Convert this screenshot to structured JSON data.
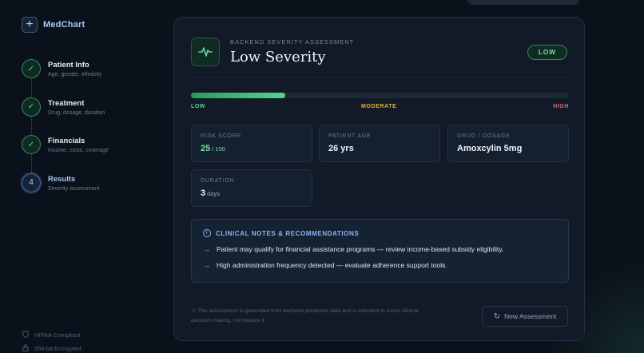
{
  "brand": {
    "icon": "plus-icon",
    "name": "MedChart"
  },
  "steps": [
    {
      "title": "Patient Info",
      "subtitle": "Age, gender, ethnicity",
      "marker": "✓",
      "state": "done"
    },
    {
      "title": "Treatment",
      "subtitle": "Drug, dosage, duration",
      "marker": "✓",
      "state": "done"
    },
    {
      "title": "Financials",
      "subtitle": "Income, costs, coverage",
      "marker": "✓",
      "state": "done"
    },
    {
      "title": "Results",
      "subtitle": "Severity assessment",
      "marker": "4",
      "state": "active"
    }
  ],
  "footer_badges": [
    {
      "icon": "shield-icon",
      "label": "HIPAA Compliant"
    },
    {
      "icon": "lock-icon",
      "label": "256-bit Encrypted"
    }
  ],
  "assessment": {
    "eyebrow": "BACKEND SEVERITY ASSESSMENT",
    "title": "Low Severity",
    "severity_badge": "LOW",
    "icon": "pulse-icon",
    "score_fraction": 0.25,
    "scale": {
      "low": "LOW",
      "moderate": "MODERATE",
      "high": "HIGH"
    },
    "colors": {
      "low": "#5fd49a",
      "moderate": "#e0b43a",
      "high": "#e46b6b",
      "accent": "#8fb4f0"
    }
  },
  "metrics": {
    "risk_score": {
      "label": "RISK SCORE",
      "value": "25",
      "unit": "/ 100"
    },
    "patient_age": {
      "label": "PATIENT AGE",
      "value": "26 yrs"
    },
    "drug_dosage": {
      "label": "DRUG / DOSAGE",
      "value": "Amoxcylin 5mg"
    },
    "duration": {
      "label": "DURATION",
      "value": "3",
      "unit": "days"
    }
  },
  "notes": {
    "title": "CLINICAL NOTES & RECOMMENDATIONS",
    "items": [
      "Patient may qualify for financial assistance programs — review income-based subsidy eligibility.",
      "High administration frequency detected — evaluate adherence support tools."
    ]
  },
  "disclaimer": "⚠ This assessment is generated from backend predictive data and is intended to assist clinical decision-making, not replace it.",
  "actions": {
    "new_assessment": "New Assessment"
  }
}
